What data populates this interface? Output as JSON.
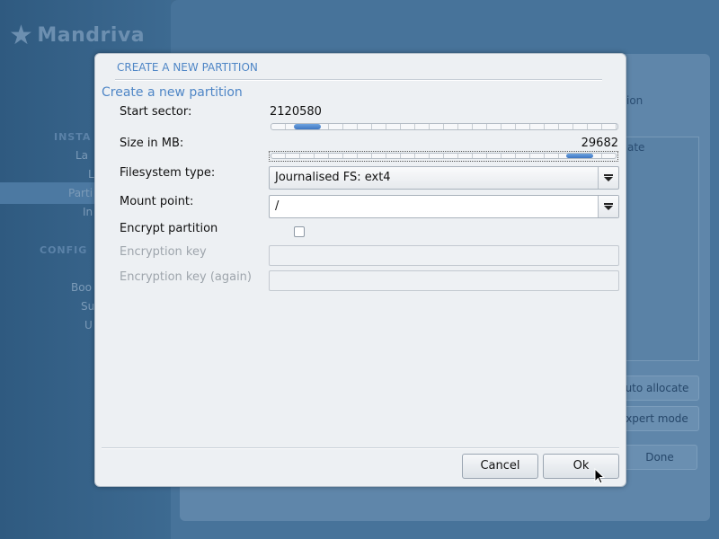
{
  "background": {
    "brand": "Mandriva",
    "sidebar_sections": [
      "INSTA",
      "CONFIG"
    ],
    "sidebar_items": [
      "La",
      "L",
      "Parti",
      "In",
      "Boo",
      "Su",
      "U"
    ],
    "main_fragments": [
      "ion",
      "ate"
    ],
    "buttons": {
      "auto_allocate": "uto allocate",
      "expert_mode": "xpert mode",
      "done": "Done"
    }
  },
  "dialog": {
    "window_title": "CREATE A NEW PARTITION",
    "subtitle": "Create a new partition",
    "fields": {
      "start_sector": {
        "label": "Start sector:",
        "value": "2120580",
        "slider_fraction": 0.07
      },
      "size_mb": {
        "label": "Size in MB:",
        "value": "29682",
        "slider_fraction": 0.93
      },
      "filesystem_type": {
        "label": "Filesystem type:",
        "value": "Journalised FS: ext4"
      },
      "mount_point": {
        "label": "Mount point:",
        "value": "/"
      },
      "encrypt_partition": {
        "label": "Encrypt partition",
        "checked": false
      },
      "encryption_key": {
        "label": "Encryption key",
        "value": ""
      },
      "encryption_key_again": {
        "label": "Encryption key (again)",
        "value": ""
      }
    },
    "buttons": {
      "cancel": "Cancel",
      "ok": "Ok"
    }
  },
  "colors": {
    "accent": "#4f86c6",
    "dialog_bg": "#edf0f3",
    "disabled_text": "#9ea5ac",
    "installer_bg": "#3f6a8f"
  },
  "icons": {
    "dropdown": "dropdown-arrow-icon",
    "logo": "mandriva-star-icon",
    "cursor": "mouse-pointer-icon"
  }
}
